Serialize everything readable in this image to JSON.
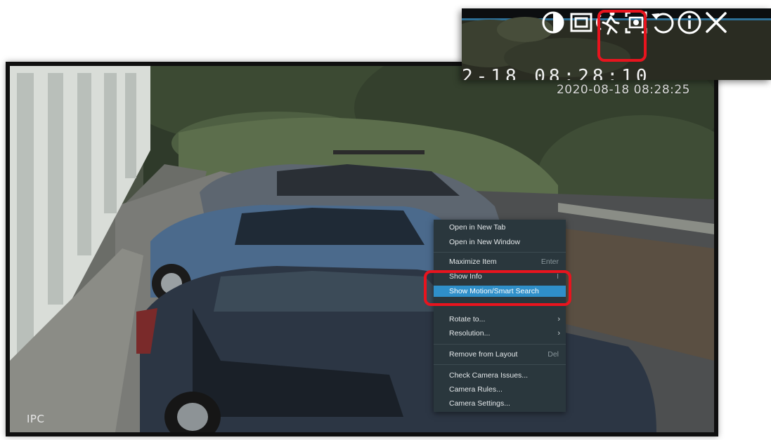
{
  "camera": {
    "timestamp": "2020-08-18 08:28:25",
    "label": "IPC"
  },
  "context_menu": {
    "items": [
      {
        "label": "Open in New Tab",
        "shortcut": "",
        "submenu": false
      },
      {
        "label": "Open in New Window",
        "shortcut": "",
        "submenu": false
      },
      {
        "label": "Maximize Item",
        "shortcut": "Enter",
        "submenu": false
      },
      {
        "label": "Show Info",
        "shortcut": "I",
        "submenu": false
      },
      {
        "label": "Show Motion/Smart Search",
        "shortcut": "",
        "submenu": false,
        "highlighted": true
      },
      {
        "label": "Rotate to...",
        "shortcut": "",
        "submenu": true
      },
      {
        "label": "Resolution...",
        "shortcut": "",
        "submenu": true
      },
      {
        "label": "Remove from Layout",
        "shortcut": "Del",
        "submenu": false
      },
      {
        "label": "Check Camera Issues...",
        "shortcut": "",
        "submenu": false
      },
      {
        "label": "Camera Rules...",
        "shortcut": "",
        "submenu": false
      },
      {
        "label": "Camera Settings...",
        "shortcut": "",
        "submenu": false
      }
    ],
    "submenu_arrow": "›"
  },
  "toolbar": {
    "icons": [
      "contrast-icon",
      "fit-frame-icon",
      "motion-search-icon",
      "screenshot-icon",
      "rotate-icon",
      "info-icon",
      "close-icon"
    ],
    "partial_timestamp": "2-18 08:28:10"
  },
  "colors": {
    "annotation": "#e8141e",
    "menu_background": "#2a373d",
    "menu_highlight": "#2f8fc9"
  }
}
